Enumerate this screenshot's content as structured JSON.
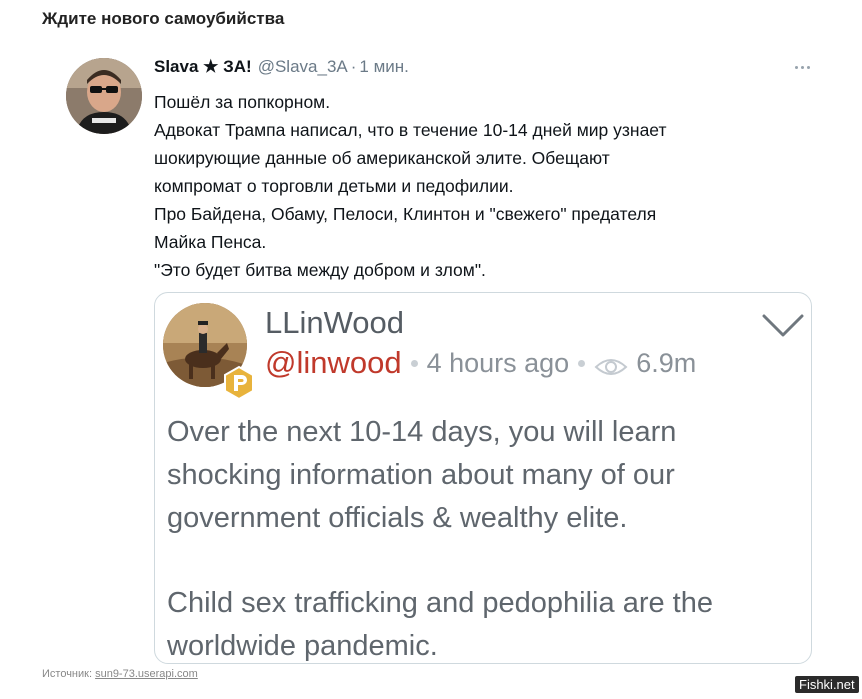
{
  "post": {
    "title": "Ждите нового самоубийства"
  },
  "tweet": {
    "author_name": "Slava ★ ЗА!",
    "handle": "@Slava_3A",
    "separator": "·",
    "time": "1 мин.",
    "more_icon": "more-horizontal-icon",
    "text_lines": [
      "Пошёл за попкорном.",
      "Адвокат Трампа написал, что в течение 10-14 дней мир узнает",
      "шокирующие данные об американской элите. Обещают",
      "компромат о торговли детьми и педофилии.",
      "Про Байдена, Обаму, Пелоси, Клинтон и \"свежего\" предателя",
      "Майка Пенса.",
      "\"Это будет битва между добром и злом\"."
    ]
  },
  "quoted": {
    "name": "LLinWood",
    "handle": "@linwood",
    "time": "4 hours ago",
    "views": "6.9m",
    "view_icon": "eye-icon",
    "menu_icon": "chevron-down-icon",
    "badge_icon": "parler-badge-icon",
    "paragraph1": [
      "Over the next 10-14 days, you will learn",
      "shocking information about many of our",
      "government officials & wealthy elite."
    ],
    "paragraph2": [
      "Child sex trafficking and pedophilia are the",
      "worldwide pandemic."
    ],
    "accent_color": "#c0392b"
  },
  "footer": {
    "source_label": "Источник:",
    "source_link": "sun9-73.userapi.com",
    "watermark": "Fishki.net"
  }
}
